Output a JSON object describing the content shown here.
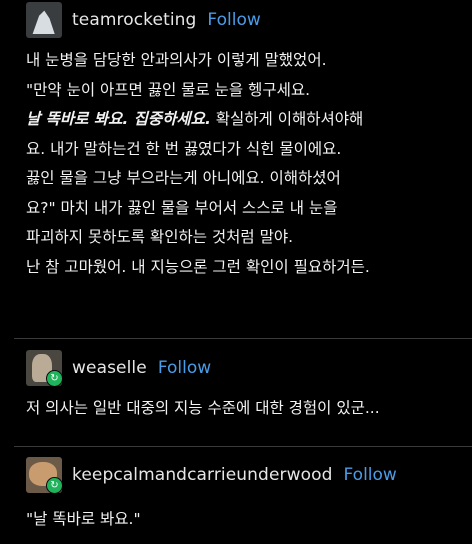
{
  "posts": [
    {
      "username": "teamrocketing",
      "follow_label": "Follow",
      "avatar_icon": "mountain-avatar",
      "lines": {
        "l1": "내 눈병을 담당한 안과의사가 이렇게 말했었어.",
        "l2": "\"만약 눈이 아프면 끓인 물로 눈을 헹구세요.",
        "l3_emph": "날 똑바로 봐요. 집중하세요.",
        "l3_rest": " 확실하게 이해하셔야해",
        "l4": "요. 내가 말하는건 한 번 끓였다가 식힌 물이에요.",
        "l5": "끓인 물을 그냥 부으라는게 아니에요. 이해하셨어",
        "l6": "요?\" 마치 내가 끓인 물을 부어서 스스로 내 눈을",
        "l7": "파괴하지 못하도록 확인하는 것처럼 말야.",
        "l8": "난 참 고마웠어. 내 지능으론 그런 확인이 필요하거든."
      }
    },
    {
      "username": "weaselle",
      "follow_label": "Follow",
      "avatar_icon": "user-avatar",
      "reblog_icon": "reblog-icon",
      "lines": {
        "l1": "저 의사는 일반 대중의 지능 수준에 대한 경험이 있군..."
      }
    },
    {
      "username": "keepcalmandcarrieunderwood",
      "follow_label": "Follow",
      "avatar_icon": "user-avatar",
      "reblog_icon": "reblog-icon",
      "lines": {
        "l1": "\"날 똑바로 봐요.\""
      }
    }
  ],
  "colors": {
    "background": "#000000",
    "text": "#f2f2f2",
    "follow": "#4a9ce8",
    "reblog_badge": "#1fb35b"
  }
}
